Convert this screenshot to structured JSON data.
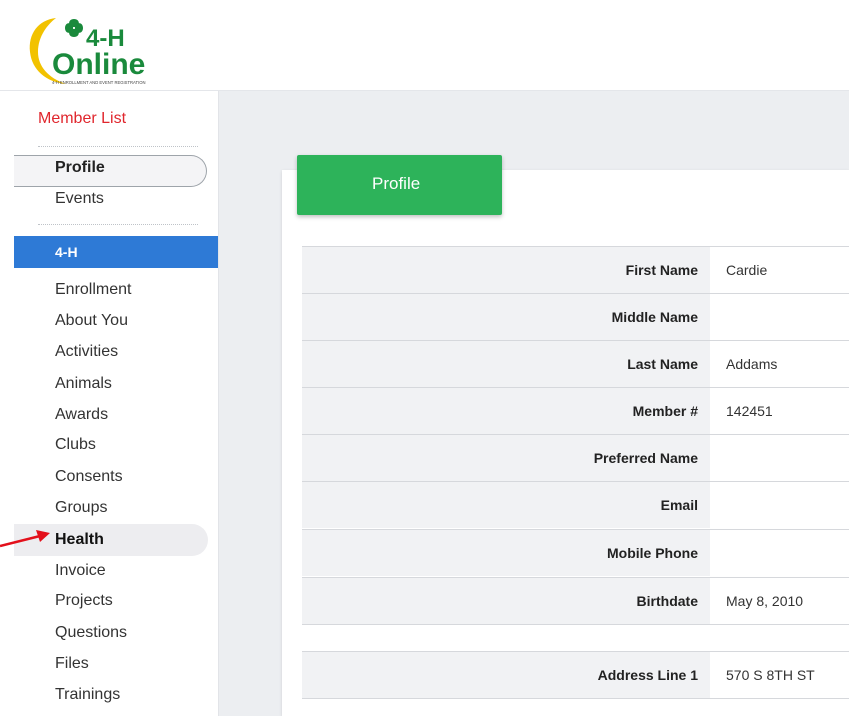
{
  "header": {
    "logo_text_top": "4-H",
    "logo_text_bottom": "Online",
    "logo_tagline": "4-H ENROLLMENT AND EVENT REGISTRATION"
  },
  "sidebar": {
    "member_list": "Member List",
    "profile": "Profile",
    "events": "Events",
    "section": "4-H",
    "items": [
      "Enrollment",
      "About You",
      "Activities",
      "Animals",
      "Awards",
      "Clubs",
      "Consents",
      "Groups",
      "Health",
      "Invoice",
      "Projects",
      "Questions",
      "Files",
      "Trainings"
    ],
    "active_item": "Health"
  },
  "main": {
    "tab_label": "Profile",
    "fields": [
      {
        "label": "First Name",
        "value": "Cardie"
      },
      {
        "label": "Middle Name",
        "value": ""
      },
      {
        "label": "Last Name",
        "value": "Addams"
      },
      {
        "label": "Member #",
        "value": "142451"
      },
      {
        "label": "Preferred Name",
        "value": ""
      },
      {
        "label": "Email",
        "value": ""
      },
      {
        "label": "Mobile Phone",
        "value": ""
      },
      {
        "label": "Birthdate",
        "value": "May 8, 2010"
      }
    ],
    "address_fields": [
      {
        "label": "Address Line 1",
        "value": "570 S 8TH ST"
      }
    ]
  },
  "colors": {
    "accent_green": "#2db35a",
    "accent_blue": "#2e7ad6",
    "member_list_red": "#e0262d",
    "arrow_red": "#e3101b"
  }
}
